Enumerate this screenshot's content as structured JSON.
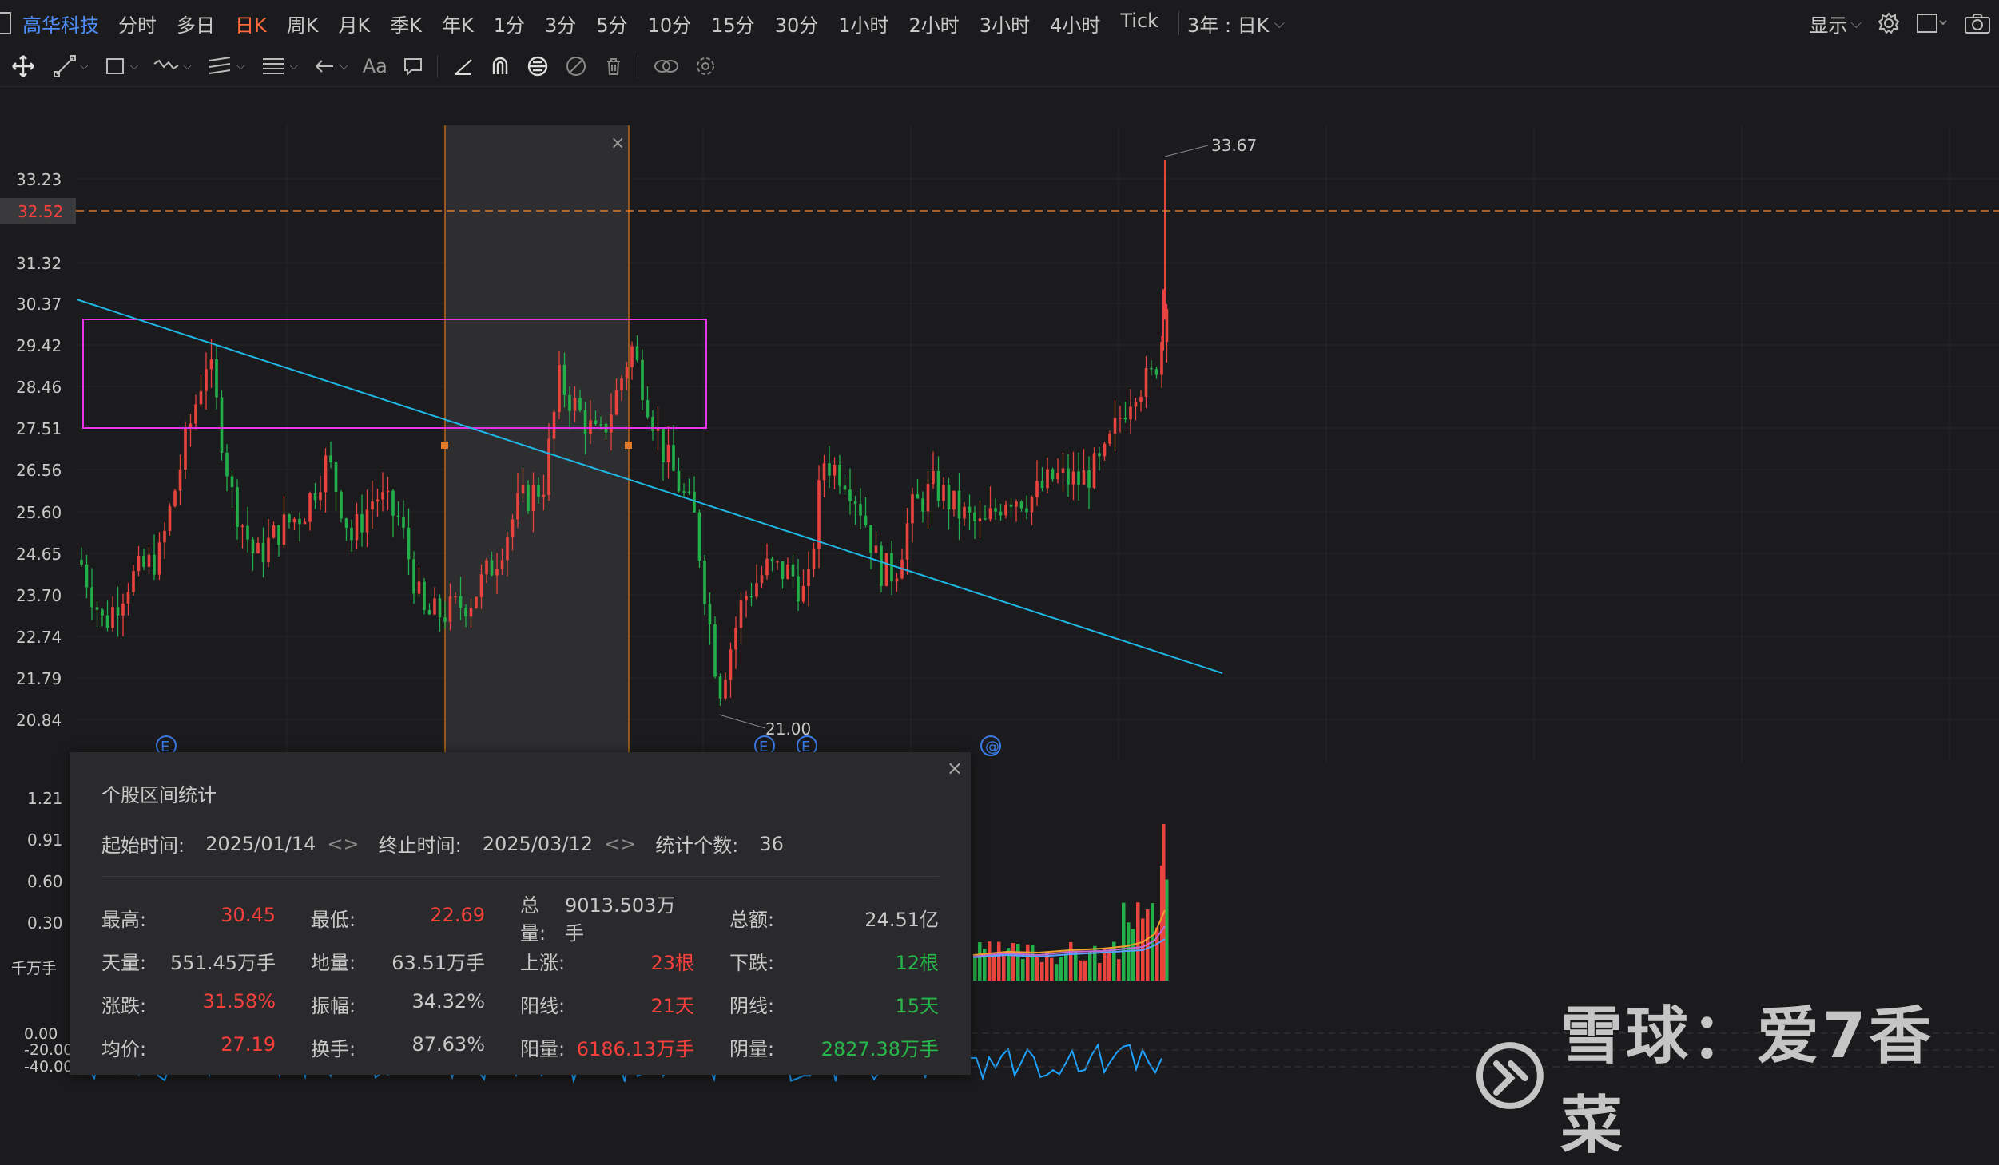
{
  "header": {
    "symbol": "高华科技",
    "periods": [
      "分时",
      "多日",
      "日K",
      "周K",
      "月K",
      "季K",
      "年K",
      "1分",
      "3分",
      "5分",
      "10分",
      "15分",
      "30分",
      "1小时",
      "2小时",
      "3小时",
      "4小时",
      "Tick"
    ],
    "active_period": "日K",
    "range_label": "3年 : 日K",
    "display_label": "显示"
  },
  "price_axis": {
    "ticks": [
      "33.23",
      "31.32",
      "30.37",
      "29.42",
      "28.46",
      "27.51",
      "26.56",
      "25.60",
      "24.65",
      "23.70",
      "22.74",
      "21.79",
      "20.84"
    ],
    "current_price": "32.52",
    "high_label": "33.67",
    "low_label": "21.00"
  },
  "volume_axis": {
    "ticks": [
      "1.21",
      "0.91",
      "0.60",
      "0.30"
    ],
    "unit": "千万手"
  },
  "indicator_axis": {
    "ticks": [
      "0.00",
      "-20.00",
      "-40.00"
    ]
  },
  "event_markers": [
    "E",
    "E",
    "E",
    "@"
  ],
  "selection": {
    "close_symbol": "×"
  },
  "stats_popup": {
    "title": "个股区间统计",
    "close_symbol": "×",
    "start_label": "起始时间:",
    "start_value": "2025/01/14",
    "end_label": "终止时间:",
    "end_value": "2025/03/12",
    "count_label": "统计个数:",
    "count_value": "36",
    "rows": [
      [
        {
          "k": "最高:",
          "v": "30.45",
          "c": "red"
        },
        {
          "k": "最低:",
          "v": "22.69",
          "c": "red"
        },
        {
          "k": "总量:",
          "v": "9013.503万手",
          "c": "white"
        },
        {
          "k": "总额:",
          "v": "24.51亿",
          "c": "white"
        }
      ],
      [
        {
          "k": "天量:",
          "v": "551.45万手",
          "c": "white"
        },
        {
          "k": "地量:",
          "v": "63.51万手",
          "c": "white"
        },
        {
          "k": "上涨:",
          "v": "23根",
          "c": "red"
        },
        {
          "k": "下跌:",
          "v": "12根",
          "c": "green"
        }
      ],
      [
        {
          "k": "涨跌:",
          "v": "31.58%",
          "c": "red"
        },
        {
          "k": "振幅:",
          "v": "34.32%",
          "c": "white"
        },
        {
          "k": "阳线:",
          "v": "21天",
          "c": "red"
        },
        {
          "k": "阴线:",
          "v": "15天",
          "c": "green"
        }
      ],
      [
        {
          "k": "均价:",
          "v": "27.19",
          "c": "red"
        },
        {
          "k": "换手:",
          "v": "87.63%",
          "c": "white"
        },
        {
          "k": "阳量:",
          "v": "6186.13万手",
          "c": "red"
        },
        {
          "k": "阴量:",
          "v": "2827.38万手",
          "c": "green"
        }
      ]
    ]
  },
  "watermark": "雪球：爱7香菜",
  "colors": {
    "up": "#e8443d",
    "down": "#23b04a",
    "trendline": "#1fb7e6",
    "box": "#e536e5",
    "price_line": "#e07b2b",
    "accent": "#ff6a3c",
    "symbol": "#4e8df7"
  }
}
